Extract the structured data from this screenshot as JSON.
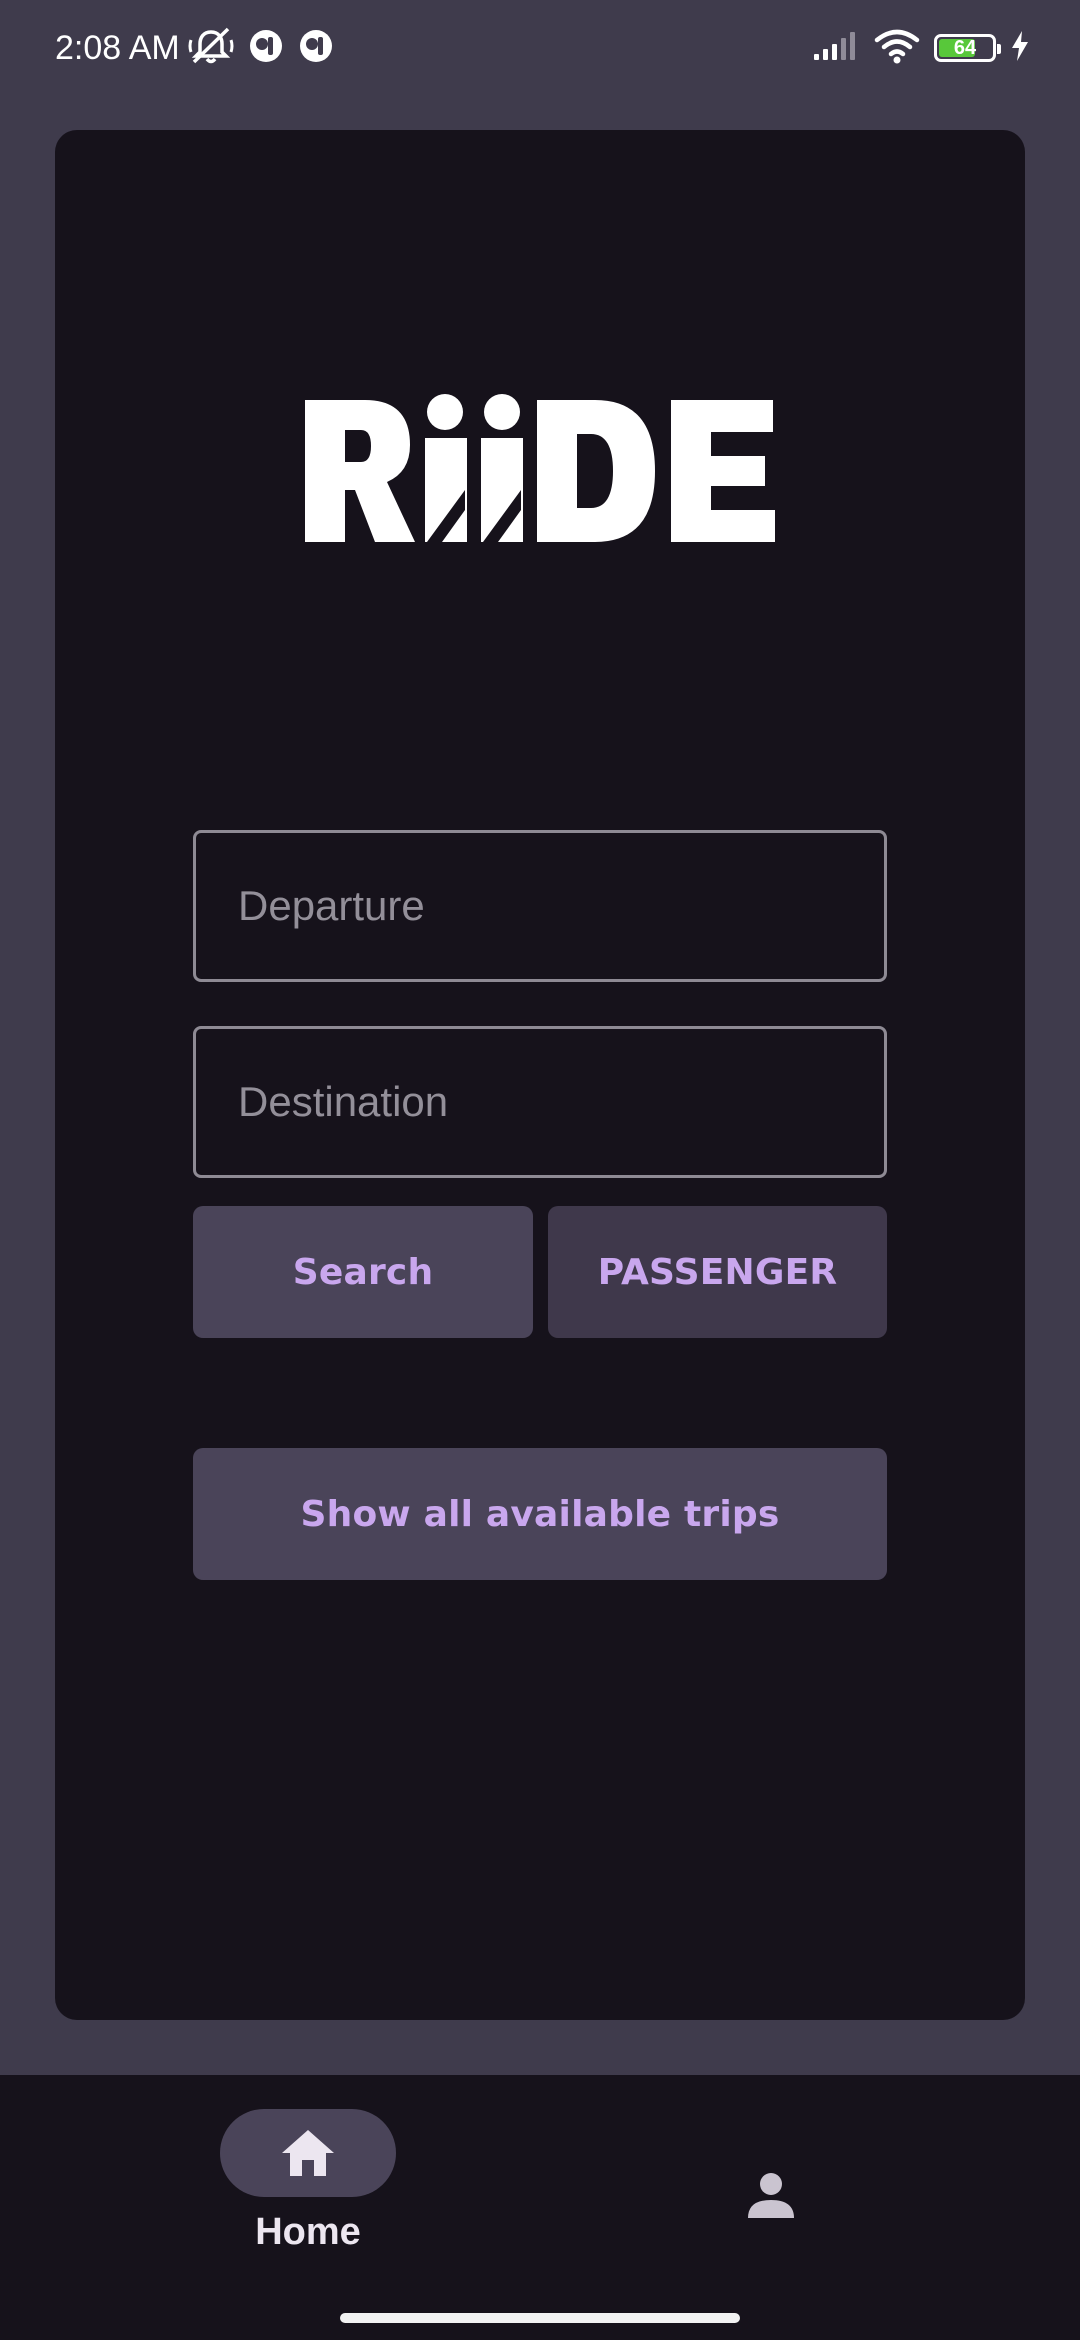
{
  "status_bar": {
    "time": "2:08 AM",
    "battery_level": "64",
    "left_icons": [
      "mute-notifications-icon",
      "app-notification-icon",
      "app-notification-icon"
    ],
    "right_icons": [
      "signal-icon",
      "wifi-icon",
      "battery-icon",
      "charging-icon"
    ]
  },
  "logo": {
    "text": "RiiDE"
  },
  "form": {
    "departure_placeholder": "Departure",
    "departure_value": "",
    "destination_placeholder": "Destination",
    "destination_value": ""
  },
  "buttons": {
    "search_label": "Search",
    "role_label": "PASSENGER",
    "all_trips_label": "Show all available trips"
  },
  "bottom_nav": {
    "items": [
      {
        "label": "Home",
        "icon": "home-icon",
        "selected": true
      },
      {
        "label": "",
        "icon": "person-icon",
        "selected": false
      }
    ]
  },
  "colors": {
    "background": "#3f3b4c",
    "card": "#16121b",
    "button": "#4a4459",
    "button_text": "#c9a7ee",
    "field_border": "#8e8a94"
  }
}
